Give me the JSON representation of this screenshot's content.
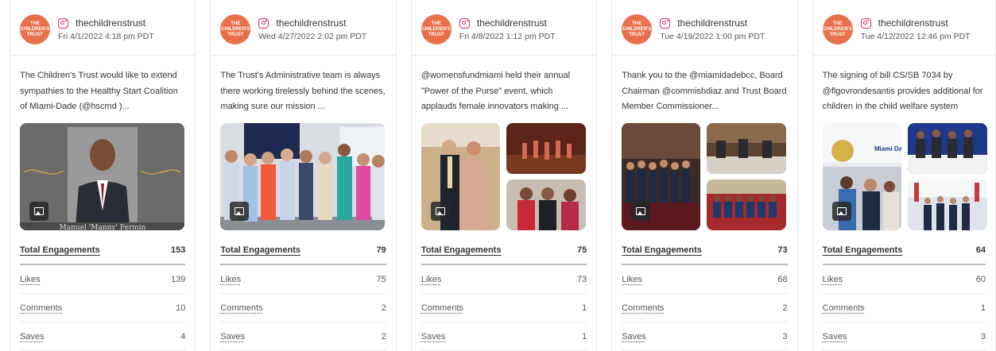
{
  "cards": [
    {
      "avatar_text": "THE CHILDREN'S TRUST",
      "handle": "thechildrenstrust",
      "date": "Fri 4/1/2022 4:18 pm PDT",
      "caption": "The Children's Trust would like to extend sympathies to the Healthy Start Coalition of Miami-Dade (@hscmd )...",
      "media_layout": "single",
      "image_caption": "Manuel 'Manny' Fermin",
      "total_label": "Total Engagements",
      "total": "153",
      "likes_label": "Likes",
      "likes": "139",
      "comments_label": "Comments",
      "comments": "10",
      "saves_label": "Saves",
      "saves": "4"
    },
    {
      "avatar_text": "THE CHILDREN'S TRUST",
      "handle": "thechildrenstrust",
      "date": "Wed 4/27/2022 2:02 pm PDT",
      "caption": "The Trust's Administrative team is always there working tirelessly behind the scenes, making sure our mission ...",
      "media_layout": "single",
      "total_label": "Total Engagements",
      "total": "79",
      "likes_label": "Likes",
      "likes": "75",
      "comments_label": "Comments",
      "comments": "2",
      "saves_label": "Saves",
      "saves": "2"
    },
    {
      "avatar_text": "THE CHILDREN'S TRUST",
      "handle": "thechildrenstrust",
      "date": "Fri 4/8/2022 1:12 pm PDT",
      "caption": "@womensfundmiami held their annual \"Power of the Purse\" event, which applauds female innovators making ...",
      "media_layout": "grid",
      "total_label": "Total Engagements",
      "total": "75",
      "likes_label": "Likes",
      "likes": "73",
      "comments_label": "Comments",
      "comments": "1",
      "saves_label": "Saves",
      "saves": "1"
    },
    {
      "avatar_text": "THE CHILDREN'S TRUST",
      "handle": "thechildrenstrust",
      "date": "Tue 4/19/2022 1:00 pm PDT",
      "caption": "Thank you to the @miamidadebcc, Board Chairman @commishdiaz and Trust Board Member Commissioner...",
      "media_layout": "grid",
      "total_label": "Total Engagements",
      "total": "73",
      "likes_label": "Likes",
      "likes": "68",
      "comments_label": "Comments",
      "comments": "2",
      "saves_label": "Saves",
      "saves": "3"
    },
    {
      "avatar_text": "THE CHILDREN'S TRUST",
      "handle": "thechildrenstrust",
      "date": "Tue 4/12/2022 12:46 pm PDT",
      "caption": "The signing of bill CS/SB 7034 by @flgovrondesantis provides additional for children in the child welfare system",
      "media_layout": "grid",
      "image_caption": "Miami Dade College",
      "total_label": "Total Engagements",
      "total": "64",
      "likes_label": "Likes",
      "likes": "60",
      "comments_label": "Comments",
      "comments": "1",
      "saves_label": "Saves",
      "saves": "3"
    }
  ],
  "icons": {
    "platform": "instagram-icon",
    "media": "image-icon"
  },
  "colors": {
    "avatar": "#e8704a",
    "instagram": "#d62976",
    "divider": "#e6e6e6"
  }
}
